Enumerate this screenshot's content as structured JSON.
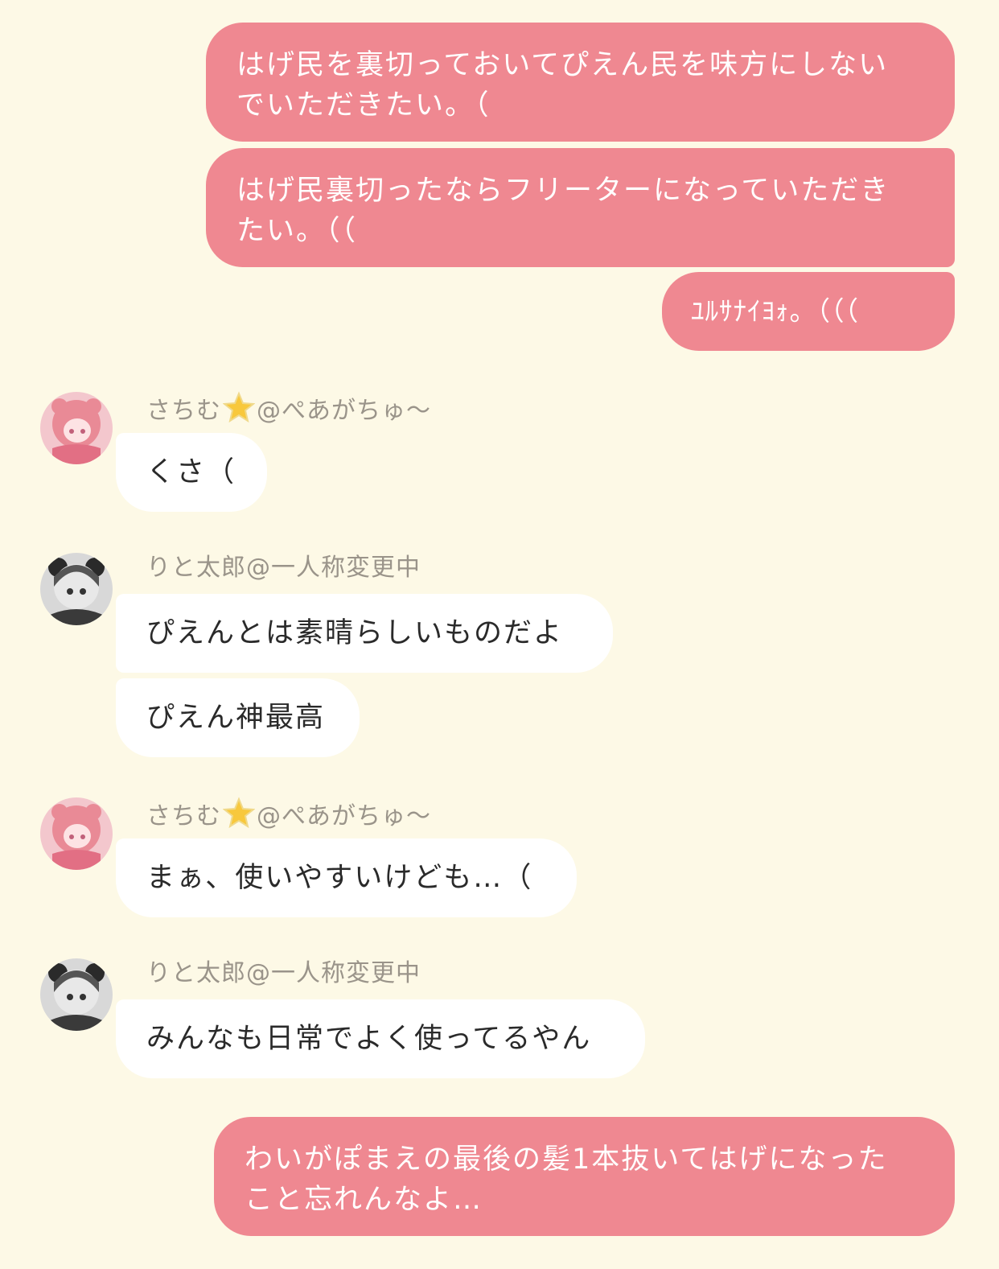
{
  "messages": [
    {
      "id": "m1",
      "direction": "outgoing",
      "text": "はげ民を裏切っておいてぴえん民を味方にしない\nでいただきたい。（"
    },
    {
      "id": "m2",
      "direction": "outgoing",
      "text": "はげ民裏切ったならフリーターになっていただき\nたい。（（"
    },
    {
      "id": "m3",
      "direction": "outgoing",
      "text": "ﾕﾙｻﾅｲﾖｫ。（（（"
    },
    {
      "id": "m4",
      "direction": "incoming",
      "sender_name": "さちむ",
      "sender_suffix": "@ぺあがちゅ～",
      "sender_emoji": "🌟",
      "text": "くさ（"
    },
    {
      "id": "m5",
      "direction": "incoming",
      "sender_name": "りと太郎@一人称変更中",
      "text": "ぴえんとは素晴らしいものだよ"
    },
    {
      "id": "m6",
      "direction": "incoming",
      "text": "ぴえん神最高"
    },
    {
      "id": "m7",
      "direction": "incoming",
      "sender_name": "さちむ",
      "sender_suffix": "@ぺあがちゅ～",
      "sender_emoji": "🌟",
      "text": "まぁ、使いやすいけども…（"
    },
    {
      "id": "m8",
      "direction": "incoming",
      "sender_name": "りと太郎@一人称変更中",
      "text": "みんなも日常でよく使ってるやん"
    },
    {
      "id": "m9",
      "direction": "outgoing",
      "text": "わいがぽまえの最後の髪1本抜いてはげになった\nこと忘れんなよ…"
    }
  ],
  "colors": {
    "background": "#fdf9e6",
    "outgoing_bubble": "#ef8891",
    "incoming_bubble": "#ffffff",
    "sender_name": "#9a948a"
  }
}
